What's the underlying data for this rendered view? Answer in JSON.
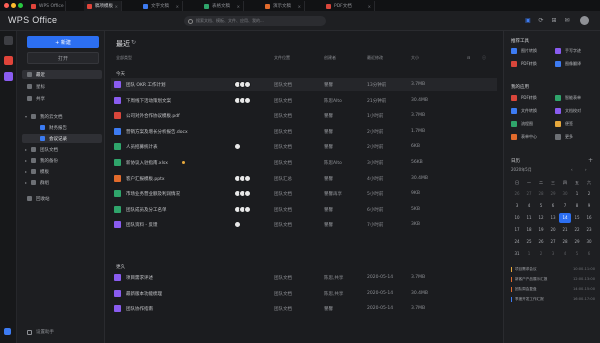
{
  "titlebar": {
    "tabs": [
      {
        "label": "WPS Office",
        "color": "#e0443a"
      },
      {
        "label": "稿项模板",
        "color": "#e0443a"
      },
      {
        "label": "文字文稿",
        "color": "#3d7bf2"
      },
      {
        "label": "表格文稿",
        "color": "#2fa56b"
      },
      {
        "label": "演示文稿",
        "color": "#e26b2c"
      },
      {
        "label": "PDF文档",
        "color": "#d9463b"
      }
    ]
  },
  "header": {
    "logo": "WPS Office",
    "search_placeholder": "搜索文档、模板、文件、应用、我的..."
  },
  "sidebar": {
    "new_label": "+ 新建",
    "open_label": "打开",
    "nav": [
      {
        "label": "最近",
        "selected": true
      },
      {
        "label": "星标"
      },
      {
        "label": "共享"
      }
    ],
    "tree": [
      {
        "label": "我的云文档",
        "expanded": true
      },
      {
        "label": "财务报告",
        "indent": 1
      },
      {
        "label": "会议记录",
        "indent": 1,
        "selected": true
      },
      {
        "label": "团队文档"
      },
      {
        "label": "我的备份"
      },
      {
        "label": "模板"
      },
      {
        "label": "群组"
      }
    ],
    "trash": "回收站",
    "bottom": "设置助手"
  },
  "main": {
    "title": "最近",
    "columns": [
      "全部类型",
      "文件位置",
      "创建者",
      "最近修改",
      "大小"
    ],
    "group_today": "今天",
    "group_week": "更久",
    "rows_today": [
      {
        "name": "团队 OKR 工作计划",
        "color": "#8a5cf0",
        "loc": "团队文档",
        "owner": "瞿馨",
        "time": "13分钟前",
        "size": "3.7MB",
        "avatars": 3
      },
      {
        "name": "下周线下活动策划文案",
        "color": "#8a5cf0",
        "loc": "团队文档",
        "owner": "陈思Alto",
        "time": "21分钟前",
        "size": "30.4MB",
        "avatars": 3
      },
      {
        "name": "公司对外合作协议模板.pdf",
        "color": "#d9463b",
        "loc": "团队文档",
        "owner": "瞿馨",
        "time": "1小时前",
        "size": "3.7MB",
        "avatars": 0
      },
      {
        "name": "营销方案及增长分析报告.docx",
        "color": "#3d7bf2",
        "loc": "团队文档",
        "owner": "瞿馨",
        "time": "2小时前",
        "size": "1.7MB",
        "avatars": 0
      },
      {
        "name": "人员招募统计表",
        "color": "#2fa56b",
        "loc": "团队文档",
        "owner": "瞿馨",
        "time": "2小时前",
        "size": "6KB",
        "avatars": 1
      },
      {
        "name": "新协议入驻指南.xlsx",
        "color": "#2fa56b",
        "loc": "团队文档",
        "owner": "陈思Alto",
        "time": "3小时前",
        "size": "56KB",
        "avatars": 0,
        "star": true
      },
      {
        "name": "客户汇报模板.pptx",
        "color": "#e26b2c",
        "loc": "团队汇总",
        "owner": "瞿馨",
        "time": "4小时前",
        "size": "30.4MB",
        "avatars": 3
      },
      {
        "name": "市场业务营业额及利润情况",
        "color": "#2fa56b",
        "loc": "团队文档",
        "owner": "瞿馨再享",
        "time": "5小时前",
        "size": "9KB",
        "avatars": 3
      },
      {
        "name": "团队成员及分工名单",
        "color": "#2fa56b",
        "loc": "团队文档",
        "owner": "瞿馨",
        "time": "6小时前",
        "size": "5KB",
        "avatars": 3
      },
      {
        "name": "团队资料 - 反馈",
        "color": "#8a5cf0",
        "loc": "团队文档",
        "owner": "瞿馨",
        "time": "7小时前",
        "size": "3KB",
        "avatars": 1
      }
    ],
    "rows_week": [
      {
        "name": "项目需求评述",
        "color": "#8a5cf0",
        "loc": "团队文档",
        "owner": "陈思,共享",
        "time": "2020-05-14",
        "size": "3.7MB"
      },
      {
        "name": "最新版本功能梳理",
        "color": "#8a5cf0",
        "loc": "团队文档",
        "owner": "陈思,共享",
        "time": "2020-05-14",
        "size": "30.4MB"
      },
      {
        "name": "团队协作指南",
        "color": "#8a5cf0",
        "loc": "团队文档",
        "owner": "瞿馨",
        "time": "2020-05-14",
        "size": "3.7MB"
      }
    ]
  },
  "right": {
    "tools_title": "推荐工具",
    "tools": [
      {
        "label": "图片转换",
        "color": "#3d7bf2"
      },
      {
        "label": "手写字迹",
        "color": "#8a5cf0"
      },
      {
        "label": "PDF转换",
        "color": "#d9463b"
      },
      {
        "label": "图像翻译",
        "color": "#3d7bf2"
      }
    ],
    "tools2_title": "我的应用",
    "tools2": [
      {
        "label": "PDF转换",
        "color": "#d9463b"
      },
      {
        "label": "智能表单",
        "color": "#2fa56b"
      },
      {
        "label": "文件转换",
        "color": "#3d7bf2"
      },
      {
        "label": "文档校对",
        "color": "#8a5cf0"
      },
      {
        "label": "流程图",
        "color": "#2fa56b"
      },
      {
        "label": "便签",
        "color": "#e7a83c"
      },
      {
        "label": "表单中心",
        "color": "#e26b2c"
      },
      {
        "label": "更多",
        "color": "#6d7075"
      }
    ],
    "calendar_title": "日历",
    "calendar_month": "2020年5月",
    "weekdays": [
      "日",
      "一",
      "二",
      "三",
      "四",
      "五",
      "六"
    ],
    "weeks": [
      [
        "26",
        "27",
        "28",
        "29",
        "30",
        "1",
        "2"
      ],
      [
        "3",
        "4",
        "5",
        "6",
        "7",
        "8",
        "9"
      ],
      [
        "10",
        "11",
        "12",
        "13",
        "14",
        "15",
        "16"
      ],
      [
        "17",
        "18",
        "19",
        "20",
        "21",
        "22",
        "23"
      ],
      [
        "24",
        "25",
        "26",
        "27",
        "28",
        "29",
        "30"
      ],
      [
        "31",
        "1",
        "2",
        "3",
        "4",
        "5",
        "6"
      ]
    ],
    "today": "14",
    "events": [
      {
        "label": "项目需求会议",
        "time": "10:00-11:00",
        "color": "#e7a83c"
      },
      {
        "label": "新客户产品展示汇报",
        "time": "12:00-13:00",
        "color": "#e26b2c"
      },
      {
        "label": "团队周会复盘",
        "time": "14:00-15:00",
        "color": "#e26b2c"
      },
      {
        "label": "季度开发工作汇报",
        "time": "16:00-17:00",
        "color": "#3d7bf2"
      }
    ]
  }
}
